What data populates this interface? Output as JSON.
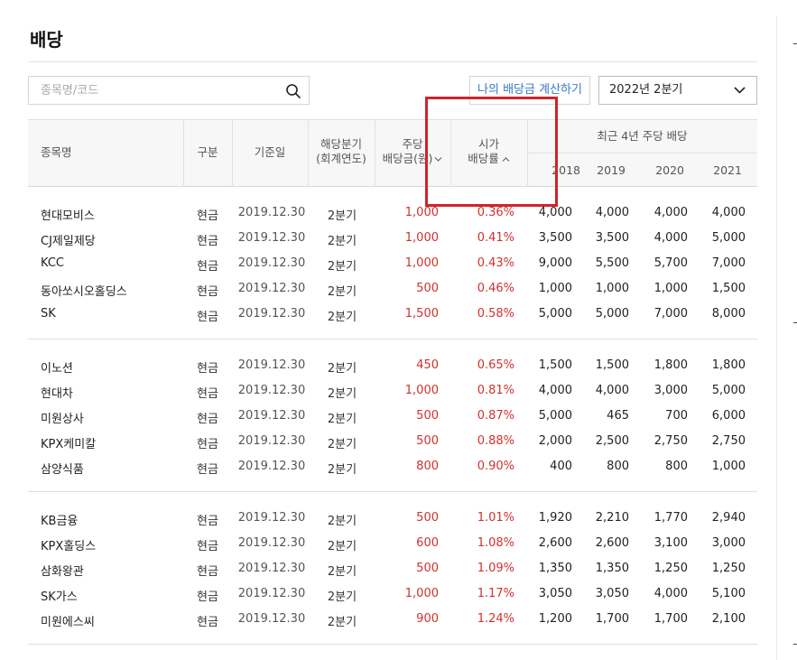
{
  "page": {
    "title": "배당",
    "search_placeholder": "종목명/코드",
    "calc_button": "나의 배당금 계산하기",
    "period_select": "2022년 2분기"
  },
  "table": {
    "headers": {
      "name": "종목명",
      "type": "구분",
      "date": "기준일",
      "quarter_l1": "해당분기",
      "quarter_l2": "(회계연도)",
      "amount_l1": "주당",
      "amount_l2": "배당금(원)",
      "yield_l1": "시가",
      "yield_l2": "배당률",
      "recent": "최근 4년 주당 배당",
      "years": [
        "2018",
        "2019",
        "2020",
        "2021"
      ]
    },
    "rows": [
      {
        "name": "현대모비스",
        "type": "현금",
        "date": "2019.12.30",
        "quarter": "2분기",
        "amount": "1,000",
        "yield": "0.36%",
        "y2018": "4,000",
        "y2019": "4,000",
        "y2020": "4,000",
        "y2021": "4,000"
      },
      {
        "name": "CJ제일제당",
        "type": "현금",
        "date": "2019.12.30",
        "quarter": "2분기",
        "amount": "1,000",
        "yield": "0.41%",
        "y2018": "3,500",
        "y2019": "3,500",
        "y2020": "4,000",
        "y2021": "5,000"
      },
      {
        "name": "KCC",
        "type": "현금",
        "date": "2019.12.30",
        "quarter": "2분기",
        "amount": "1,000",
        "yield": "0.43%",
        "y2018": "9,000",
        "y2019": "5,500",
        "y2020": "5,700",
        "y2021": "7,000"
      },
      {
        "name": "동아쏘시오홀딩스",
        "type": "현금",
        "date": "2019.12.30",
        "quarter": "2분기",
        "amount": "500",
        "yield": "0.46%",
        "y2018": "1,000",
        "y2019": "1,000",
        "y2020": "1,000",
        "y2021": "1,500"
      },
      {
        "name": "SK",
        "type": "현금",
        "date": "2019.12.30",
        "quarter": "2분기",
        "amount": "1,500",
        "yield": "0.58%",
        "y2018": "5,000",
        "y2019": "5,000",
        "y2020": "7,000",
        "y2021": "8,000"
      },
      {
        "name": "이노션",
        "type": "현금",
        "date": "2019.12.30",
        "quarter": "2분기",
        "amount": "450",
        "yield": "0.65%",
        "y2018": "1,500",
        "y2019": "1,500",
        "y2020": "1,800",
        "y2021": "1,800"
      },
      {
        "name": "현대차",
        "type": "현금",
        "date": "2019.12.30",
        "quarter": "2분기",
        "amount": "1,000",
        "yield": "0.81%",
        "y2018": "4,000",
        "y2019": "4,000",
        "y2020": "3,000",
        "y2021": "5,000"
      },
      {
        "name": "미원상사",
        "type": "현금",
        "date": "2019.12.30",
        "quarter": "2분기",
        "amount": "500",
        "yield": "0.87%",
        "y2018": "5,000",
        "y2019": "465",
        "y2020": "700",
        "y2021": "6,000"
      },
      {
        "name": "KPX케미칼",
        "type": "현금",
        "date": "2019.12.30",
        "quarter": "2분기",
        "amount": "500",
        "yield": "0.88%",
        "y2018": "2,000",
        "y2019": "2,500",
        "y2020": "2,750",
        "y2021": "2,750"
      },
      {
        "name": "삼양식품",
        "type": "현금",
        "date": "2019.12.30",
        "quarter": "2분기",
        "amount": "800",
        "yield": "0.90%",
        "y2018": "400",
        "y2019": "800",
        "y2020": "800",
        "y2021": "1,000"
      },
      {
        "name": "KB금융",
        "type": "현금",
        "date": "2019.12.30",
        "quarter": "2분기",
        "amount": "500",
        "yield": "1.01%",
        "y2018": "1,920",
        "y2019": "2,210",
        "y2020": "1,770",
        "y2021": "2,940"
      },
      {
        "name": "KPX홀딩스",
        "type": "현금",
        "date": "2019.12.30",
        "quarter": "2분기",
        "amount": "600",
        "yield": "1.08%",
        "y2018": "2,600",
        "y2019": "2,600",
        "y2020": "3,100",
        "y2021": "3,000"
      },
      {
        "name": "삼화왕관",
        "type": "현금",
        "date": "2019.12.30",
        "quarter": "2분기",
        "amount": "500",
        "yield": "1.09%",
        "y2018": "1,350",
        "y2019": "1,350",
        "y2020": "1,250",
        "y2021": "1,250"
      },
      {
        "name": "SK가스",
        "type": "현금",
        "date": "2019.12.30",
        "quarter": "2분기",
        "amount": "1,000",
        "yield": "1.17%",
        "y2018": "3,050",
        "y2019": "3,050",
        "y2020": "4,000",
        "y2021": "5,100"
      },
      {
        "name": "미원에스씨",
        "type": "현금",
        "date": "2019.12.30",
        "quarter": "2분기",
        "amount": "900",
        "yield": "1.24%",
        "y2018": "1,200",
        "y2019": "1,700",
        "y2020": "1,700",
        "y2021": "2,100"
      }
    ]
  },
  "colors": {
    "accent_red": "#d0312d",
    "link_blue": "#3a78c8",
    "highlight_box": "#d1232a"
  }
}
